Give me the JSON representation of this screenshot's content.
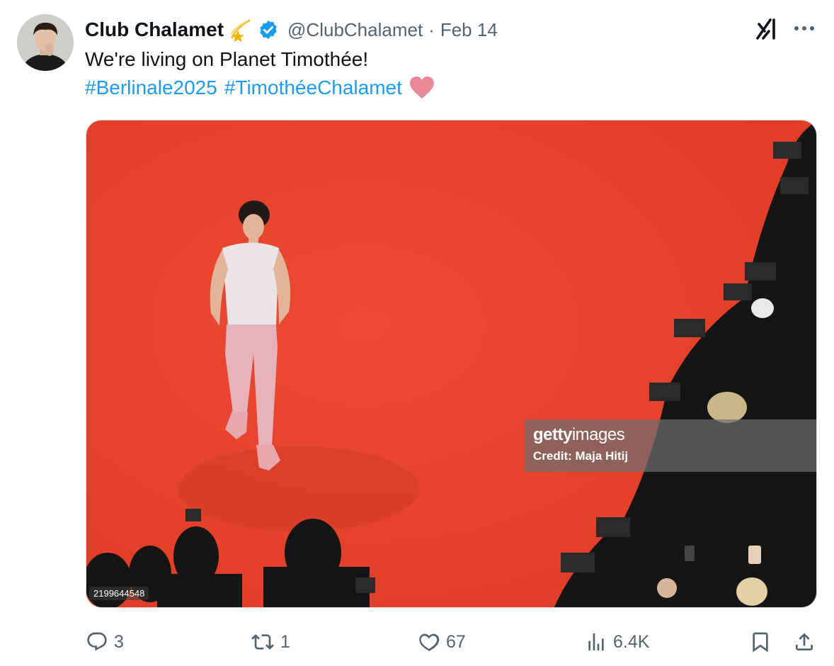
{
  "author": {
    "display_name": "Club Chalamet",
    "handle": "@ClubChalamet",
    "separator": "·",
    "date": "Feb 14",
    "name_emoji": "shooting-star-emoji",
    "verified_color": "#1d9bf0"
  },
  "post": {
    "text": "We're living on Planet Timothée!",
    "hashtags": [
      "#Berlinale2025",
      "#TimothéeChalamet"
    ],
    "trailing_emoji": "pink-heart-emoji"
  },
  "media": {
    "watermark_brand_bold": "getty",
    "watermark_brand_light": "images",
    "watermark_credit": "Credit: Maja Hitij",
    "image_id": "2199644548",
    "carpet_color": "#e8412b"
  },
  "actions": {
    "replies": "3",
    "reposts": "1",
    "likes": "67",
    "views": "6.4K"
  },
  "colors": {
    "link": "#1d9bf0",
    "muted": "#536471",
    "text": "#0f1419"
  }
}
